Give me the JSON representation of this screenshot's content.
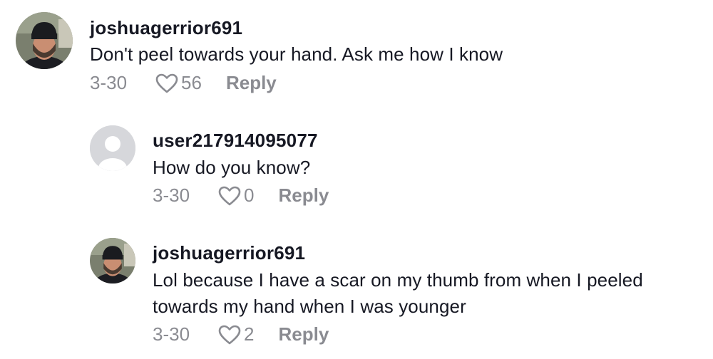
{
  "comments": [
    {
      "username": "joshuagerrior691",
      "text": "Don't peel towards your hand. Ask me how I know",
      "date": "3-30",
      "likes": "56",
      "reply_label": "Reply",
      "avatar": "user-photo"
    },
    {
      "username": "user217914095077",
      "text": "How do you know?",
      "date": "3-30",
      "likes": "0",
      "reply_label": "Reply",
      "avatar": "default-avatar"
    },
    {
      "username": "joshuagerrior691",
      "text": "Lol because I have a scar on my thumb from when I peeled towards my hand when I was younger",
      "date": "3-30",
      "likes": "2",
      "reply_label": "Reply",
      "avatar": "user-photo"
    }
  ],
  "colors": {
    "text": "#161823",
    "muted": "#8a8b91",
    "default_avatar_bg": "#d6d7db"
  },
  "icons": {
    "like": "heart-outline-icon"
  }
}
